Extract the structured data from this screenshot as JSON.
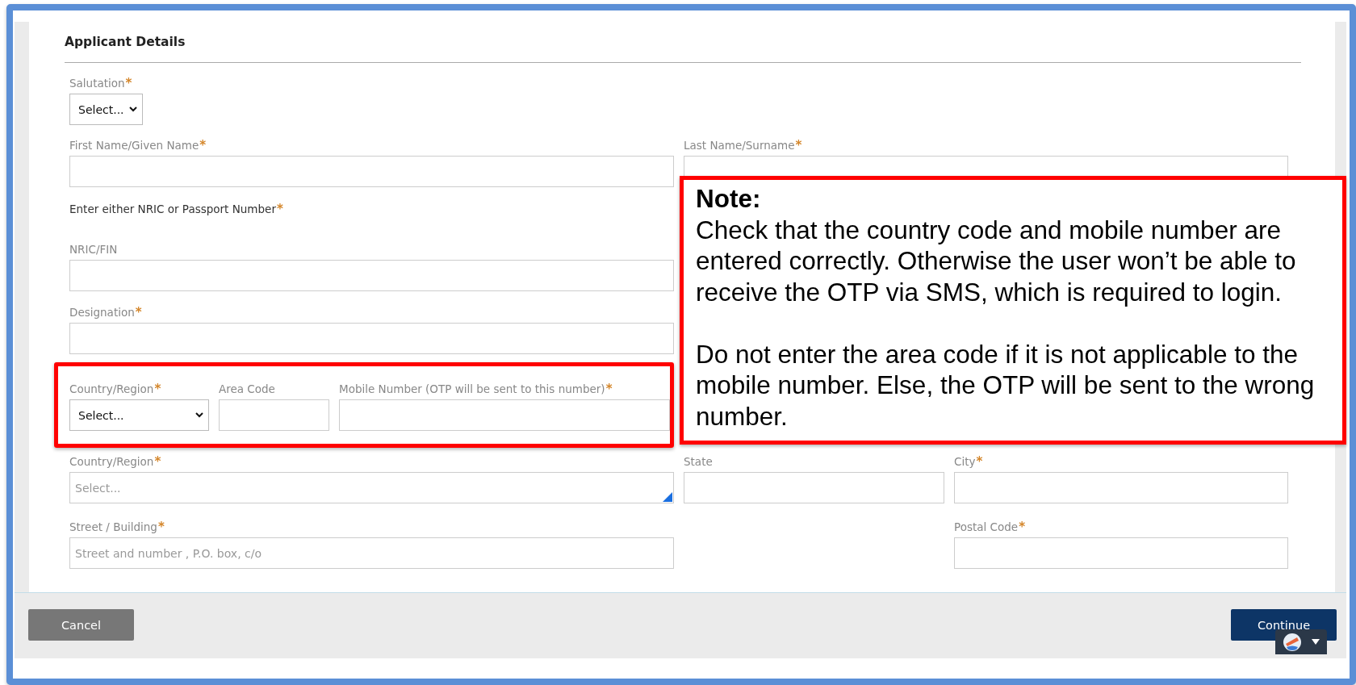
{
  "section_title": "Applicant Details",
  "rows": [
    {
      "kind": "single",
      "fields": [
        {
          "kind": "select",
          "label": "Salutation",
          "required_mark": "*",
          "value": "Select..."
        }
      ]
    },
    {
      "kind": "pair",
      "fields": [
        {
          "kind": "text",
          "label": "First Name/Given Name",
          "required_mark": "*"
        },
        {
          "kind": "text",
          "label": "Last Name/Surname",
          "required_mark": "*"
        }
      ]
    },
    {
      "kind": "instruction",
      "text": "Enter either NRIC or Passport Number",
      "required_mark": "*"
    },
    {
      "kind": "single",
      "fields": [
        {
          "kind": "text",
          "label": "NRIC/FIN"
        }
      ]
    },
    {
      "kind": "single",
      "fields": [
        {
          "kind": "text",
          "label": "Designation",
          "required_mark": "*"
        }
      ]
    },
    {
      "kind": "phone",
      "highlighted": true,
      "fields": [
        {
          "kind": "select",
          "label": "Country/Region",
          "required_mark": "*",
          "value": "Select..."
        },
        {
          "kind": "text",
          "label": "Area Code"
        },
        {
          "kind": "text",
          "label": "Mobile Number (OTP will be sent to this number)",
          "required_mark": "*"
        }
      ]
    },
    {
      "kind": "triple",
      "fields": [
        {
          "kind": "combo",
          "label": "Country/Region",
          "required_mark": "*",
          "placeholder": "Select..."
        },
        {
          "kind": "text",
          "label": "State"
        },
        {
          "kind": "text",
          "label": "City",
          "required_mark": "*"
        }
      ]
    },
    {
      "kind": "split",
      "fields": [
        {
          "kind": "text",
          "label": "Street / Building",
          "required_mark": "*",
          "placeholder": "Street and number , P.O. box, c/o"
        },
        {
          "kind": "text",
          "label": "Postal Code",
          "required_mark": "*"
        }
      ]
    }
  ],
  "footer": {
    "buttons": [
      {
        "kind": "secondary",
        "label": "Cancel"
      },
      {
        "kind": "primary",
        "label": "Continue"
      }
    ]
  },
  "note": {
    "title": "Note:",
    "paragraphs": [
      "Check that the country code and mobile number are entered correctly. Otherwise the user won’t be able to receive the OTP via SMS, which is required to login.",
      "Do not enter the area code if it is not applicable to the mobile number. Else, the OTP will be sent to the wrong number."
    ]
  }
}
